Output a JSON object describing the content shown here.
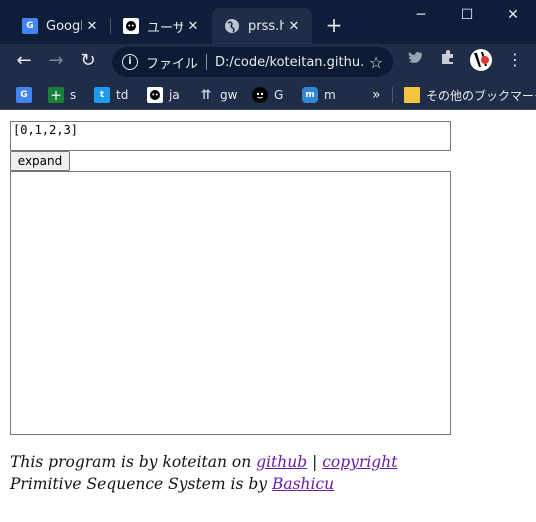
{
  "browser": {
    "tabs": [
      {
        "title": "Google",
        "favicon": "google-translate-icon",
        "active": false
      },
      {
        "title": "ユーザー",
        "favicon": "github-user-icon",
        "active": false
      },
      {
        "title": "prss.htm",
        "favicon": "globe-icon",
        "active": true
      }
    ],
    "new_tab_symbol": "+",
    "window_controls": {
      "minimize": "─",
      "maximize": "☐",
      "close": "✕"
    },
    "address_bar": {
      "scheme_label": "ファイル",
      "url": "D:/code/koteitan.githu..."
    },
    "bookmarks": [
      {
        "label": "",
        "icon": "google-translate-icon"
      },
      {
        "label": "s",
        "icon": "sheets-icon"
      },
      {
        "label": "td",
        "icon": "twitter-icon"
      },
      {
        "label": "ja",
        "icon": "github-icon"
      },
      {
        "label": "gw",
        "icon": "up-arrows-icon"
      },
      {
        "label": "G",
        "icon": "face-icon"
      },
      {
        "label": "m",
        "icon": "mastodon-icon"
      }
    ],
    "bookmarks_overflow": "»",
    "other_bookmarks_label": "その他のブックマーク"
  },
  "page": {
    "input_value": "[0,1,2,3]",
    "expand_button_label": "expand",
    "output_value": "",
    "footer": {
      "line1_prefix": "This program is by koteitan on ",
      "github_link": "github",
      "separator": " | ",
      "copyright_link": "copyright",
      "line2_prefix": "Primitive Sequence System is by ",
      "author_link": "Bashicu"
    }
  },
  "colors": {
    "tabstrip": "#0e1e3a",
    "toolbar": "#1f2d48",
    "link": "#1a0dab",
    "visited_link": "#681da8"
  }
}
